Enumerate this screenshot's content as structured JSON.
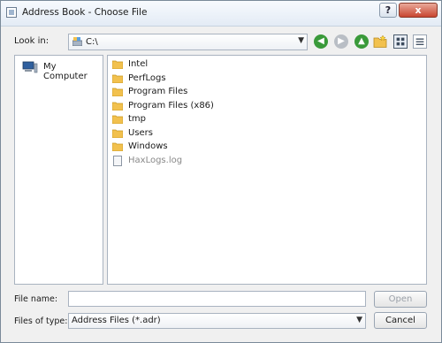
{
  "window": {
    "title": "Address Book - Choose File",
    "help_label": "?",
    "close_label": "x"
  },
  "toolbar": {
    "look_in_label": "Look in:",
    "look_in_value": "C:\\",
    "icons": [
      "back-arrow-icon",
      "forward-arrow-icon",
      "up-folder-icon",
      "new-folder-icon",
      "detail-view-icon",
      "list-view-icon"
    ]
  },
  "sidebar": {
    "items": [
      {
        "label": "My Computer",
        "icon": "computer-icon"
      }
    ]
  },
  "files": [
    {
      "name": "Intel",
      "type": "folder"
    },
    {
      "name": "PerfLogs",
      "type": "folder"
    },
    {
      "name": "Program Files",
      "type": "folder"
    },
    {
      "name": "Program Files (x86)",
      "type": "folder"
    },
    {
      "name": "tmp",
      "type": "folder"
    },
    {
      "name": "Users",
      "type": "folder"
    },
    {
      "name": "Windows",
      "type": "folder"
    },
    {
      "name": "HaxLogs.log",
      "type": "file"
    }
  ],
  "form": {
    "file_name_label": "File name:",
    "file_name_value": "",
    "files_of_type_label": "Files of type:",
    "files_of_type_value": "Address Files (*.adr)",
    "open_label": "Open",
    "cancel_label": "Cancel"
  },
  "colors": {
    "folder": "#f2c14e",
    "accent_green": "#3a9a3a",
    "title_bar": "#e3ebf5"
  }
}
